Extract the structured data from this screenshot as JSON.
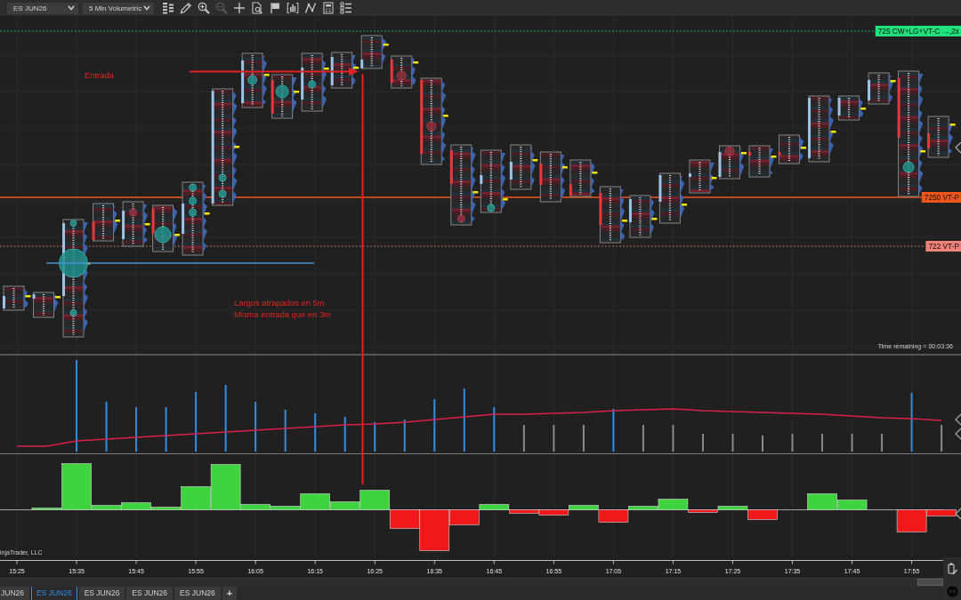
{
  "toolbar": {
    "instrument": "ES JUN26",
    "bar_type": "5 Min Volumetric",
    "tools": [
      {
        "disabled": false
      },
      {
        "disabled": false
      },
      {
        "disabled": false
      },
      {
        "disabled": true
      },
      {
        "disabled": false
      },
      {
        "disabled": false
      },
      {
        "disabled": false
      },
      {
        "disabled": false
      },
      {
        "disabled": false
      },
      {
        "disabled": false
      },
      {
        "disabled": false
      }
    ]
  },
  "chart": {
    "price_levels": [
      {
        "label": "725 CW+LG+VT-C →,2x",
        "color": "#1fe07a",
        "kind": "dotted"
      },
      {
        "label": "7250 VT-P",
        "color": "#f0561a",
        "kind": "solid"
      },
      {
        "label": "722 VT-P",
        "color": "#f08178",
        "kind": "dotted"
      }
    ],
    "entry_label": "Entrada",
    "note": [
      "Largos atrapados en 5m.",
      "Misma entrada que en 3m"
    ],
    "time_remaining": "Time remaining = 00:03:36",
    "copyright": "injaTrader, LLC",
    "time_axis": [
      "15:25",
      "15:35",
      "15:45",
      "15:55",
      "16:05",
      "16:15",
      "16:25",
      "16:35",
      "16:45",
      "16:55",
      "17:05",
      "17:15",
      "17:25",
      "17:35",
      "17:45",
      "17:55"
    ]
  },
  "tabs": [
    {
      "label": "JUN26",
      "selected": false
    },
    {
      "label": "ES JUN26",
      "selected": true
    },
    {
      "label": "ES JUN26",
      "selected": false
    },
    {
      "label": "ES JUN26",
      "selected": false
    },
    {
      "label": "ES JUN26",
      "selected": false
    }
  ],
  "add_tab": "+"
}
